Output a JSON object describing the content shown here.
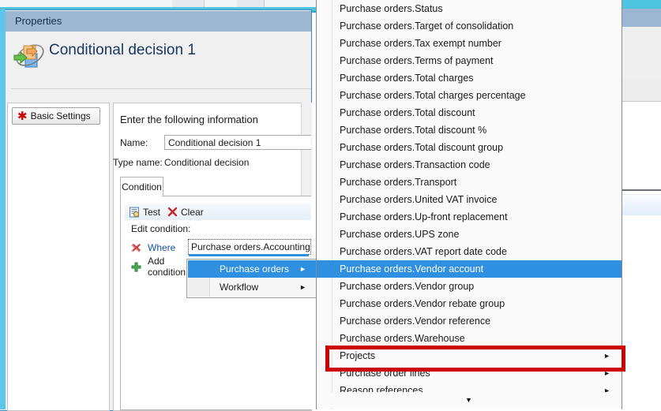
{
  "window": {
    "properties_title": "Properties",
    "page_title": "Conditional decision 1",
    "icon_name": "conditional-decision-icon"
  },
  "left_panel": {
    "basic_settings_label": "Basic Settings",
    "star_glyph": "✱"
  },
  "form": {
    "instruction": "Enter the following information",
    "name_label": "Name:",
    "name_value": "Conditional decision 1",
    "type_label": "Type name:",
    "type_value": "Conditional decision"
  },
  "tabs": [
    {
      "label": "Condition",
      "selected": true
    }
  ],
  "command_bar": {
    "test_label": "Test",
    "clear_label": "Clear"
  },
  "condition": {
    "edit_condition_label": "Edit condition:",
    "where_label": "Where",
    "add_condition_label": "Add condition",
    "combo_value": "Purchase orders.Accounting d",
    "delete_glyph": "✖",
    "add_glyph": "✚"
  },
  "context_menu": {
    "items": [
      {
        "label": "Purchase orders",
        "has_submenu": true,
        "selected": true
      },
      {
        "label": "Workflow",
        "has_submenu": true,
        "selected": false
      }
    ]
  },
  "dropdown": {
    "scroll_down_glyph": "▼",
    "submenu_arrow": "►",
    "items": [
      {
        "label": "Purchase orders.Status",
        "has_submenu": false,
        "selected": false
      },
      {
        "label": "Purchase orders.Target of consolidation",
        "has_submenu": false,
        "selected": false
      },
      {
        "label": "Purchase orders.Tax exempt number",
        "has_submenu": false,
        "selected": false
      },
      {
        "label": "Purchase orders.Terms of payment",
        "has_submenu": false,
        "selected": false
      },
      {
        "label": "Purchase orders.Total charges",
        "has_submenu": false,
        "selected": false
      },
      {
        "label": "Purchase orders.Total charges percentage",
        "has_submenu": false,
        "selected": false
      },
      {
        "label": "Purchase orders.Total discount",
        "has_submenu": false,
        "selected": false
      },
      {
        "label": "Purchase orders.Total discount %",
        "has_submenu": false,
        "selected": false
      },
      {
        "label": "Purchase orders.Total discount group",
        "has_submenu": false,
        "selected": false
      },
      {
        "label": "Purchase orders.Transaction code",
        "has_submenu": false,
        "selected": false
      },
      {
        "label": "Purchase orders.Transport",
        "has_submenu": false,
        "selected": false
      },
      {
        "label": "Purchase orders.United VAT invoice",
        "has_submenu": false,
        "selected": false
      },
      {
        "label": "Purchase orders.Up-front replacement",
        "has_submenu": false,
        "selected": false
      },
      {
        "label": "Purchase orders.UPS zone",
        "has_submenu": false,
        "selected": false
      },
      {
        "label": "Purchase orders.VAT report date code",
        "has_submenu": false,
        "selected": false
      },
      {
        "label": "Purchase orders.Vendor account",
        "has_submenu": false,
        "selected": true
      },
      {
        "label": "Purchase orders.Vendor group",
        "has_submenu": false,
        "selected": false
      },
      {
        "label": "Purchase orders.Vendor rebate group",
        "has_submenu": false,
        "selected": false
      },
      {
        "label": "Purchase orders.Vendor reference",
        "has_submenu": false,
        "selected": false
      },
      {
        "label": "Purchase orders.Warehouse",
        "has_submenu": false,
        "selected": false
      },
      {
        "label": "Projects",
        "has_submenu": true,
        "selected": false
      },
      {
        "label": "Purchase order lines",
        "has_submenu": true,
        "selected": false
      },
      {
        "label": "Reason references",
        "has_submenu": true,
        "selected": false
      }
    ]
  },
  "annotation": {
    "target_label": "Projects",
    "color": "#cc0000"
  },
  "colors": {
    "accent_cyan": "#5ec6e8",
    "title_blue": "#17375e",
    "selection_blue": "#2f8fe0",
    "titlebar_blue": "#9db6d2",
    "annotation_red": "#cc0000"
  }
}
